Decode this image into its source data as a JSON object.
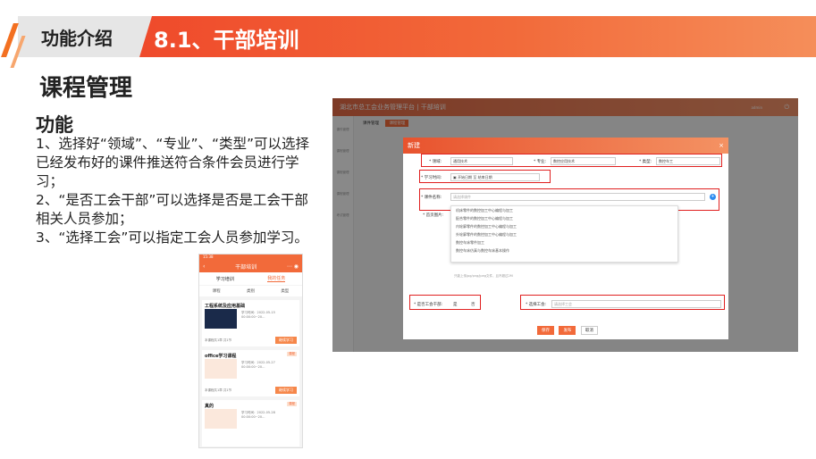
{
  "header": {
    "label": "功能介绍",
    "title": "8.1、干部培训"
  },
  "section_title": "课程管理",
  "subsection": "功能",
  "description": [
    "1、选择好“领域”、“专业”、“类型”可以选择已经发布好的课件推送符合条件会员进行学习；",
    "2、“是否工会干部”可以选择是否是工会干部相关人员参加；",
    "3、“选择工会”可以指定工会人员参加学习。"
  ],
  "phone": {
    "status": "15:38",
    "title": "干部培训",
    "tabs": [
      "学习培训",
      "我的任务"
    ],
    "filters": [
      "课程",
      "类别",
      "类型"
    ],
    "cards": [
      {
        "title": "工程系统及应用基础",
        "tag": "课程",
        "date": "学习时间：2022-05-15 00:00:00~20...",
        "foot": "本课程共1章 共1节",
        "button": "继续学习"
      },
      {
        "title": "office学习课程",
        "tag": "课程",
        "date": "学习时间：2022-05-27 00:00:00~20...",
        "foot": "本课程共1章 共1节",
        "button": "继续学习"
      },
      {
        "title": "真的",
        "tag": "课程",
        "date": "学习时间：2022-05-28 00:00:00~20...",
        "foot": "",
        "button": ""
      }
    ]
  },
  "app": {
    "title": "湖北市总工会业务管理平台 | 干部培训",
    "user": "admin",
    "tabs": [
      "课件管理",
      "课程管理"
    ],
    "side_items": [
      "课件管理",
      "课程管理",
      "课程管理",
      "课程管理",
      "考试管理"
    ],
    "dialog": {
      "title": "新建",
      "close": "×",
      "field_domain_label": "* 领域:",
      "field_domain_value": "通用技术",
      "field_major_label": "* 专业:",
      "field_major_value": "数控应用技术",
      "field_type_label": "* 类型:",
      "field_type_value": "数控车工",
      "field_time_label": "* 学习时间:",
      "field_time_start": "开始日期",
      "field_time_sep": "至",
      "field_time_end": "结束日期",
      "field_course_label": "* 课件名称:",
      "field_course_placeholder": "请选择课件",
      "field_cover_label": "* 首页图片:",
      "options": [
        "机床零件的数控加工中心编程与加工",
        "配合零件的数控加工中心编程与加工",
        "内轮廓零件的数控加工中心编程与加工",
        "外轮廓零件的数控加工中心编程与加工",
        "数控车床零件加工",
        "数控车床仿真与数控车床基本操作"
      ],
      "upload_hint": "只能上传jpg/png/jpeg文件，且不超过2M",
      "field_cadre_label": "* 是否工会干部:",
      "field_cadre_yes": "是",
      "field_cadre_no": "否",
      "field_union_label": "* 选择工会:",
      "field_union_placeholder": "请选择工会",
      "btn_save": "保存",
      "btn_publish": "发布",
      "btn_cancel": "取消"
    }
  }
}
